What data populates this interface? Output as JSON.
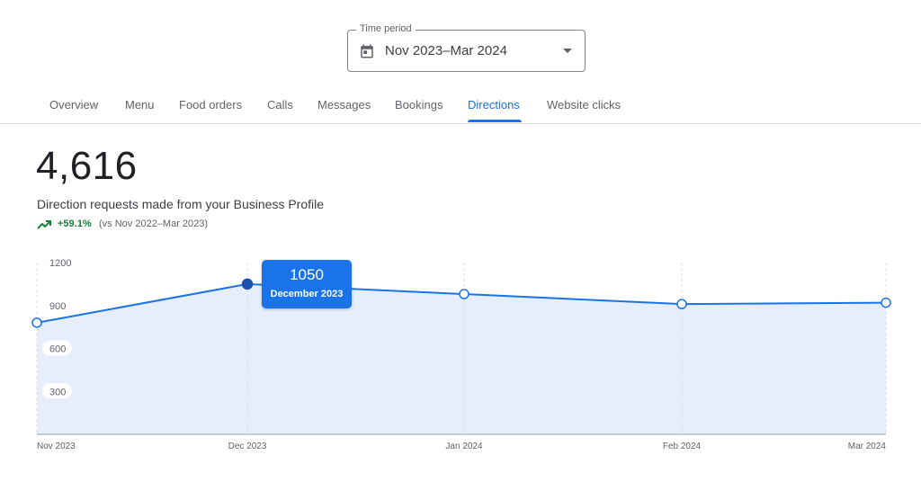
{
  "time_period": {
    "legend": "Time period",
    "value": "Nov 2023–Mar 2024",
    "icon": "calendar-icon"
  },
  "tabs": [
    {
      "label": "Overview",
      "active": false
    },
    {
      "label": "Menu",
      "active": false
    },
    {
      "label": "Food orders",
      "active": false
    },
    {
      "label": "Calls",
      "active": false
    },
    {
      "label": "Messages",
      "active": false
    },
    {
      "label": "Bookings",
      "active": false
    },
    {
      "label": "Directions",
      "active": true
    },
    {
      "label": "Website clicks",
      "active": false
    }
  ],
  "metric": {
    "value": "4,616",
    "description": "Direction requests made from your Business Profile",
    "change": "+59.1%",
    "comparison": "(vs Nov 2022–Mar 2023)",
    "trend_icon": "trending-up-icon"
  },
  "colors": {
    "accent": "#1a73e8",
    "positive": "#188038",
    "area_fill": "#e6eefb"
  },
  "tooltip": {
    "value": "1050",
    "label": "December 2023"
  },
  "chart_data": {
    "type": "area",
    "categories": [
      "Nov 2023",
      "Dec 2023",
      "Jan 2024",
      "Feb 2024",
      "Mar 2024"
    ],
    "series": [
      {
        "values": [
          780,
          1050,
          980,
          910,
          920
        ]
      }
    ],
    "y_ticks": [
      300,
      600,
      900,
      1200
    ],
    "ylim": [
      0,
      1200
    ],
    "highlighted_index": 1,
    "grid": "vertical dashed",
    "title": "",
    "xlabel": "",
    "ylabel": ""
  }
}
